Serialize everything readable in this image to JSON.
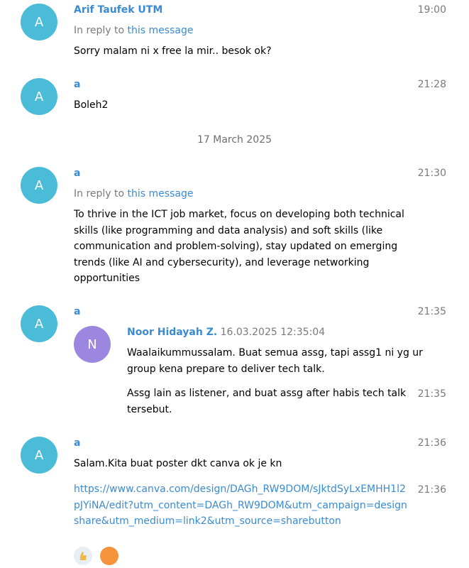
{
  "messages": [
    {
      "avatar_letter": "A",
      "sender": "Arif Taufek UTM",
      "time": "19:00",
      "reply_prefix": "In reply to",
      "reply_link": "this message",
      "text": "Sorry malam ni x free la mir.. besok ok?"
    },
    {
      "avatar_letter": "A",
      "sender": "a",
      "time": "21:28",
      "text": "Boleh2"
    },
    {
      "avatar_letter": "A",
      "sender": "a",
      "time": "21:30",
      "reply_prefix": "In reply to",
      "reply_link": "this message",
      "text": "To thrive in the ICT job market, focus on developing both technical skills (like programming and data analysis) and soft skills (like communication and problem-solving), stay updated on emerging trends (like AI and cybersecurity), and leverage networking opportunities"
    },
    {
      "avatar_letter": "A",
      "sender": "a",
      "time": "21:35",
      "forward": {
        "avatar_letter": "N",
        "name": "Noor Hidayah Z.",
        "date": "16.03.2025 12:35:04",
        "para1": "Waalaikummussalam. Buat semua assg, tapi assg1 ni yg ur group kena prepare to deliver tech talk.",
        "para2": "Assg lain as listener, and buat assg after habis tech talk tersebut.",
        "para2_time": "21:35"
      }
    },
    {
      "avatar_letter": "A",
      "sender": "a",
      "time": "21:36",
      "text": "Salam.Kita buat poster dkt canva ok je kn",
      "link_text": "https://www.canva.com/design/DAGh_RW9DOM/sJktdSyLxEMHH1l2pJYiNA/edit?utm_content=DAGh_RW9DOM&utm_campaign=designshare&utm_medium=link2&utm_source=sharebutton",
      "link_time": "21:36"
    }
  ],
  "date_separator": "17 March 2025",
  "colors": {
    "avatar_a": "#4bbcd8",
    "avatar_n": "#9b86e0",
    "sender": "#3a8bd1",
    "timestamp": "#7a7a7a"
  }
}
